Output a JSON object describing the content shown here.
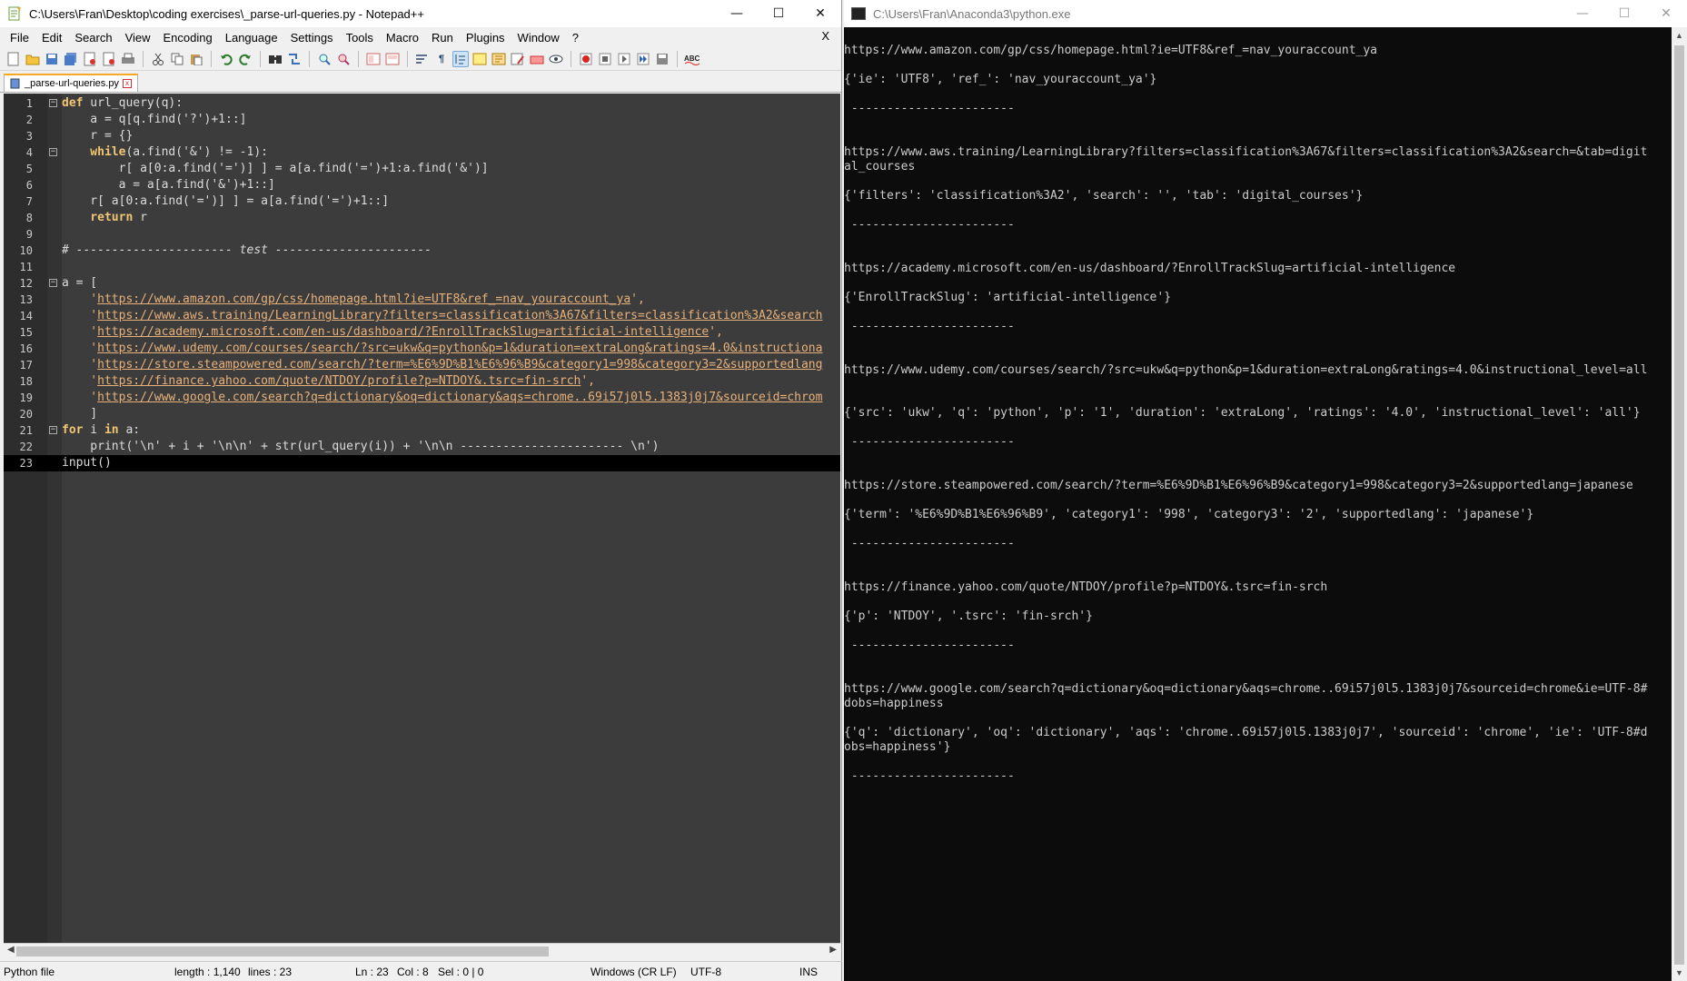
{
  "npp": {
    "title": "C:\\Users\\Fran\\Desktop\\coding exercises\\_parse-url-queries.py - Notepad++",
    "menu": [
      "File",
      "Edit",
      "Search",
      "View",
      "Encoding",
      "Language",
      "Settings",
      "Tools",
      "Macro",
      "Run",
      "Plugins",
      "Window",
      "?"
    ],
    "menu_close": "X",
    "tab_label": "_parse-url-queries.py",
    "status": {
      "filetype": "Python file",
      "length": "length : 1,140",
      "lines": "lines : 23",
      "ln": "Ln : 23",
      "col": "Col : 8",
      "sel": "Sel : 0 | 0",
      "eol": "Windows (CR LF)",
      "encoding": "UTF-8",
      "mode": "INS"
    },
    "line_numbers": [
      "1",
      "2",
      "3",
      "4",
      "5",
      "6",
      "7",
      "8",
      "9",
      "10",
      "11",
      "12",
      "13",
      "14",
      "15",
      "16",
      "17",
      "18",
      "19",
      "20",
      "21",
      "22",
      "23"
    ]
  },
  "console": {
    "title": "C:\\Users\\Fran\\Anaconda3\\python.exe",
    "lines": [
      "https://www.amazon.com/gp/css/homepage.html?ie=UTF8&ref_=nav_youraccount_ya",
      "{'ie': 'UTF8', 'ref_': 'nav_youraccount_ya'}",
      " -----------------------",
      "https://www.aws.training/LearningLibrary?filters=classification%3A67&filters=classification%3A2&search=&tab=digit",
      "al_courses",
      "{'filters': 'classification%3A2', 'search': '', 'tab': 'digital_courses'}",
      " -----------------------",
      "https://academy.microsoft.com/en-us/dashboard/?EnrollTrackSlug=artificial-intelligence",
      "{'EnrollTrackSlug': 'artificial-intelligence'}",
      " -----------------------",
      "https://www.udemy.com/courses/search/?src=ukw&q=python&p=1&duration=extraLong&ratings=4.0&instructional_level=all",
      "{'src': 'ukw', 'q': 'python', 'p': '1', 'duration': 'extraLong', 'ratings': '4.0', 'instructional_level': 'all'}",
      " -----------------------",
      "https://store.steampowered.com/search/?term=%E6%9D%B1%E6%96%B9&category1=998&category3=2&supportedlang=japanese",
      "{'term': '%E6%9D%B1%E6%96%B9', 'category1': '998', 'category3': '2', 'supportedlang': 'japanese'}",
      " -----------------------",
      "https://finance.yahoo.com/quote/NTDOY/profile?p=NTDOY&.tsrc=fin-srch",
      "{'p': 'NTDOY', '.tsrc': 'fin-srch'}",
      " -----------------------",
      "https://www.google.com/search?q=dictionary&oq=dictionary&aqs=chrome..69i57j0l5.1383j0j7&sourceid=chrome&ie=UTF-8#",
      "dobs=happiness",
      "{'q': 'dictionary', 'oq': 'dictionary', 'aqs': 'chrome..69i57j0l5.1383j0j7', 'sourceid': 'chrome', 'ie': 'UTF-8#d",
      "obs=happiness'}",
      " -----------------------"
    ]
  },
  "code": {
    "l1_kw": "def",
    "l1_rest": " url_query(q):",
    "l2": "    a = q[q.find('?')+1::]",
    "l3": "    r = {}",
    "l4_kw": "    while",
    "l4_rest": "(a.find('&') != -1):",
    "l5": "        r[ a[0:a.find('=')] ] = a[a.find('=')+1:a.find('&')]",
    "l6": "        a = a[a.find('&')+1::]",
    "l7": "    r[ a[0:a.find('=')] ] = a[a.find('=')+1::]",
    "l8_kw": "    return",
    "l8_rest": " r",
    "l10": "# ---------------------- test ----------------------",
    "l12": "a = [",
    "urls": [
      "https://www.amazon.com/gp/css/homepage.html?ie=UTF8&ref_=nav_youraccount_ya",
      "https://www.aws.training/LearningLibrary?filters=classification%3A67&filters=classification%3A2&search",
      "https://academy.microsoft.com/en-us/dashboard/?EnrollTrackSlug=artificial-intelligence",
      "https://www.udemy.com/courses/search/?src=ukw&q=python&p=1&duration=extraLong&ratings=4.0&instructiona",
      "https://store.steampowered.com/search/?term=%E6%9D%B1%E6%96%B9&category1=998&category3=2&supportedlang",
      "https://finance.yahoo.com/quote/NTDOY/profile?p=NTDOY&.tsrc=fin-srch",
      "https://www.google.com/search?q=dictionary&oq=dictionary&aqs=chrome..69i57j0l5.1383j0j7&sourceid=chrom"
    ],
    "l20": "    ]",
    "l21_kw1": "for",
    "l21_mid": " i ",
    "l21_kw2": "in",
    "l21_rest": " a:",
    "l22": "    print('\\n' + i + '\\n\\n' + str(url_query(i)) + '\\n\\n ----------------------- \\n')",
    "l23": "input()"
  }
}
